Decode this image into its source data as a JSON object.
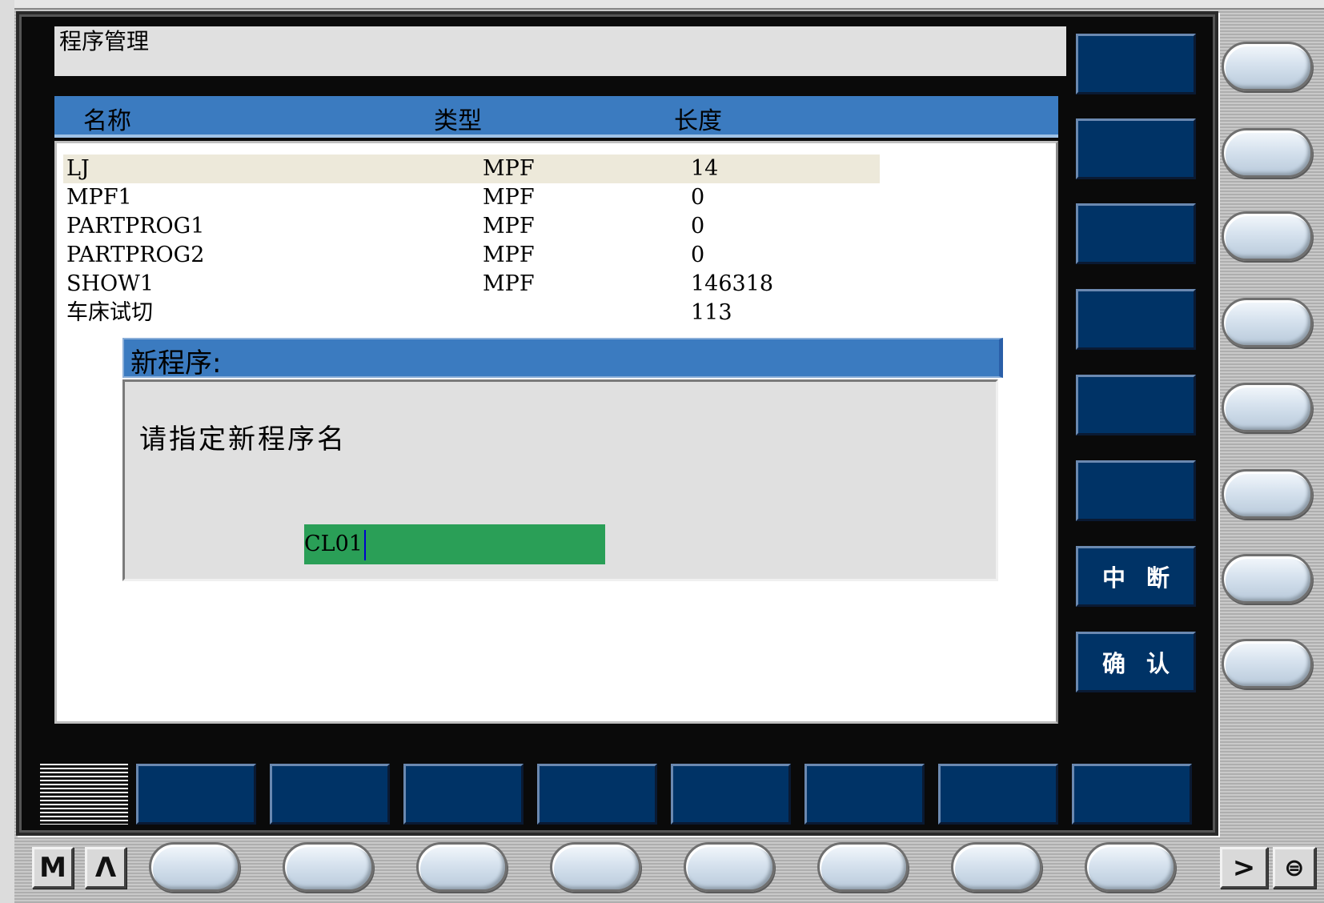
{
  "header": {
    "title": "程序管理"
  },
  "columns": {
    "name": "名称",
    "type": "类型",
    "length": "长度"
  },
  "programs": [
    {
      "name": "LJ",
      "type": "MPF",
      "length": "14"
    },
    {
      "name": "MPF1",
      "type": "MPF",
      "length": "0"
    },
    {
      "name": "PARTPROG1",
      "type": "MPF",
      "length": "0"
    },
    {
      "name": "PARTPROG2",
      "type": "MPF",
      "length": "0"
    },
    {
      "name": "SHOW1",
      "type": "MPF",
      "length": "146318"
    },
    {
      "name": "车床试切",
      "type": "",
      "length": "113"
    }
  ],
  "dialog": {
    "title": "新程序:",
    "prompt": "请指定新程序名",
    "input_value": "CL01"
  },
  "softkeys_vertical": [
    "",
    "",
    "",
    "",
    "",
    "",
    "中断",
    "确认"
  ],
  "bottom_left_buttons": {
    "m": "M",
    "caret": "Λ"
  },
  "bottom_right_buttons": {
    "next": ">",
    "menu": "⊜"
  },
  "colors": {
    "header_blue": "#3b7bc0",
    "softkey_navy": "#003366",
    "input_green": "#2a9f57",
    "selected_row": "#ede9da"
  }
}
